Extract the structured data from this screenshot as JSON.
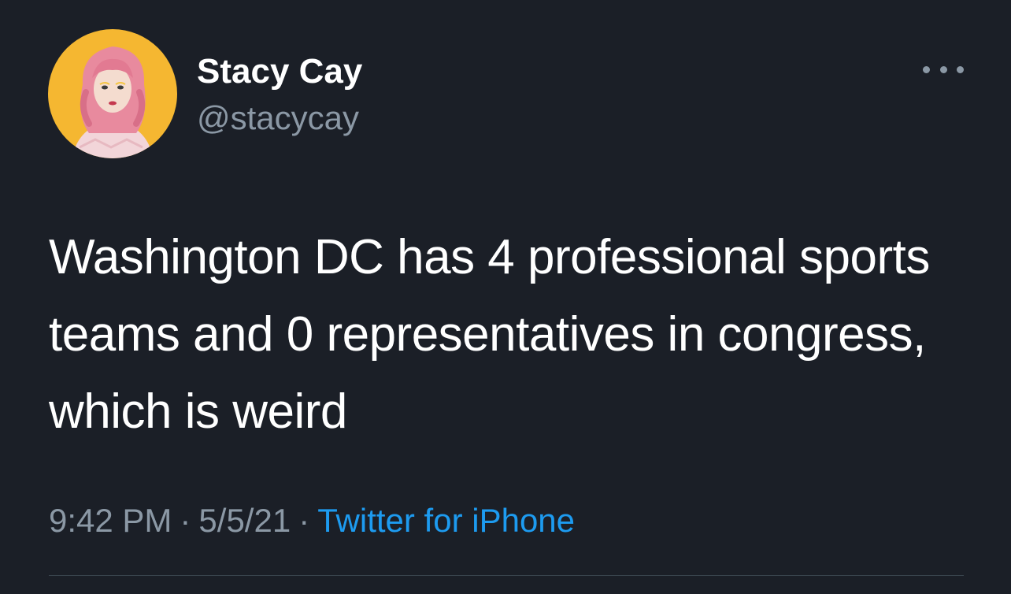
{
  "tweet": {
    "author": {
      "display_name": "Stacy Cay",
      "handle": "@stacycay",
      "avatar": "profile-photo-avatar"
    },
    "more_icon": "more-horizontal-icon",
    "text": "Washington DC has 4 professional sports teams and 0 representatives in congress, which is weird",
    "time": "9:42 PM",
    "date": "5/5/21",
    "separator": "·",
    "source": "Twitter for iPhone"
  },
  "colors": {
    "background": "#1b1f27",
    "primary_text": "#ffffff",
    "secondary_text": "#8b98a5",
    "link": "#1d9bf0",
    "avatar_background": "#f5b731",
    "avatar_hair": "#e88a9e"
  }
}
